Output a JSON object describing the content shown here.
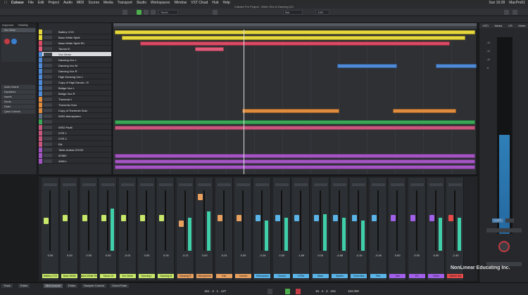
{
  "menubar": {
    "app": "Cubase",
    "items": [
      "File",
      "Edit",
      "Project",
      "Audio",
      "MIDI",
      "Scores",
      "Media",
      "Transport",
      "Studio",
      "Workspaces",
      "Window",
      "VST Cloud",
      "Hub",
      "Help"
    ],
    "clock": "Sun 16:28",
    "user": "MacPro61"
  },
  "window": {
    "title": "Cubase Pro Project - When She is Dancing 011"
  },
  "toolbar": {
    "touch": "Touch",
    "bar": "Bar",
    "quantize": "1/16"
  },
  "inspector": {
    "tabs": [
      "Inspector",
      "Visibility"
    ],
    "track": "Vox Verse",
    "sections": [
      "Audio Inserts",
      "Equalizers",
      "Inserts",
      "Sends",
      "Fader",
      "Quick Controls"
    ]
  },
  "tracks": [
    {
      "name": "Battery 3 03",
      "color": "#e6d83c",
      "sel": false
    },
    {
      "name": "Bass White Spirit",
      "color": "#e6d83c",
      "sel": false
    },
    {
      "name": "Bass White Spirit R0",
      "color": "#d94a64",
      "sel": false
    },
    {
      "name": "Taurus III",
      "color": "#e05b7a",
      "sel": false
    },
    {
      "name": "Vox Verse",
      "color": "#4f8ad6",
      "sel": true
    },
    {
      "name": "Dancing Vox L",
      "color": "#4f8ad6",
      "sel": false
    },
    {
      "name": "Dancing Vox M",
      "color": "#4f8ad6",
      "sel": false
    },
    {
      "name": "Dancing Vox R",
      "color": "#4f8ad6",
      "sel": false
    },
    {
      "name": "High Dancing Vox L",
      "color": "#4f8ad6",
      "sel": false
    },
    {
      "name": "Copy of High Dancin...R",
      "color": "#4f8ad6",
      "sel": false
    },
    {
      "name": "Bridge Vox L",
      "color": "#4f8ad6",
      "sel": false
    },
    {
      "name": "Bridge Vox R",
      "color": "#4f8ad6",
      "sel": false
    },
    {
      "name": "Theremin I",
      "color": "#e08c3e",
      "sel": false
    },
    {
      "name": "Theremin Solo",
      "color": "#e08c3e",
      "sel": false
    },
    {
      "name": "Copy of Theremin Solo",
      "color": "#e08c3e",
      "sel": false
    },
    {
      "name": "WSD Atmosphere",
      "color": "#5f6e82",
      "sel": false
    },
    {
      "name": "",
      "color": "#3aa856",
      "sel": false
    },
    {
      "name": "WSD Pad6",
      "color": "#c8577e",
      "sel": false
    },
    {
      "name": "GTR 1",
      "color": "#c8577e",
      "sel": false
    },
    {
      "name": "GTR 2",
      "color": "#c8577e",
      "sel": false
    },
    {
      "name": "Elk",
      "color": "#c8577e",
      "sel": false
    },
    {
      "name": "Table Arabia GOOD",
      "color": "#a355c2",
      "sel": false
    },
    {
      "name": "AT860",
      "color": "#a355c2",
      "sel": false
    },
    {
      "name": "4060 L",
      "color": "#a355c2",
      "sel": false
    }
  ],
  "mixer": {
    "channels": [
      {
        "name": "Battery 3 03",
        "val": "0.00",
        "color": "#c8e86a",
        "meter": 0.0,
        "cap": 0.5
      },
      {
        "name": "Bass White",
        "val": "0.00",
        "color": "#c8e86a",
        "meter": 0.0,
        "cap": 0.55
      },
      {
        "name": "Bass White R0",
        "val": "0.00",
        "color": "#c8e86a",
        "meter": 0.0,
        "cap": 0.55
      },
      {
        "name": "Taurus III",
        "val": "0.00",
        "color": "#c8e86a",
        "meter": 0.7,
        "cap": 0.55
      },
      {
        "name": "Vox Verse",
        "val": "-0.01",
        "color": "#c8e86a",
        "meter": 0.0,
        "cap": 0.55
      },
      {
        "name": "Dancing L",
        "val": "0.00",
        "color": "#c8e86a",
        "meter": 0.0,
        "cap": 0.55
      },
      {
        "name": "Dancing M",
        "val": "0.00",
        "color": "#c8e86a",
        "meter": 0.0,
        "cap": 0.55
      },
      {
        "name": "Dancing R",
        "val": "-0.21",
        "color": "#e8a060",
        "meter": 0.55,
        "cap": 0.45
      },
      {
        "name": "Microphone",
        "val": "0.00",
        "color": "#e8a060",
        "meter": 0.65,
        "cap": 0.9
      },
      {
        "name": "Fall",
        "val": "-0.01",
        "color": "#e8a060",
        "meter": 0.0,
        "cap": 0.55
      },
      {
        "name": "Current",
        "val": "0.00",
        "color": "#e8a060",
        "meter": 0.0,
        "cap": 0.55
      },
      {
        "name": "Percussion",
        "val": "-4.26",
        "color": "#5ab4e8",
        "meter": 0.5,
        "cap": 0.55
      },
      {
        "name": "Chorus",
        "val": "0.00",
        "color": "#5ab4e8",
        "meter": 0.55,
        "cap": 0.55
      },
      {
        "name": "GTRs",
        "val": "-1.69",
        "color": "#5ab4e8",
        "meter": 0.0,
        "cap": 0.55
      },
      {
        "name": "Bass",
        "val": "0.00",
        "color": "#5ab4e8",
        "meter": 0.6,
        "cap": 0.55
      },
      {
        "name": "Synths",
        "val": "-4.88",
        "color": "#5ab4e8",
        "meter": 0.55,
        "cap": 0.55
      },
      {
        "name": "Drum Bus",
        "val": "-4.10",
        "color": "#5ab4e8",
        "meter": 0.5,
        "cap": 0.55
      },
      {
        "name": "Rev",
        "val": "-0.45",
        "color": "#5ab4e8",
        "meter": 0.0,
        "cap": 0.55
      },
      {
        "name": "Vox",
        "val": "0.60",
        "color": "#a060e8",
        "meter": 0.0,
        "cap": 0.55
      },
      {
        "name": "FX",
        "val": "0.00",
        "color": "#a060e8",
        "meter": 0.0,
        "cap": 0.55
      },
      {
        "name": "Echo",
        "val": "0.00",
        "color": "#a060e8",
        "meter": 0.55,
        "cap": 0.55
      },
      {
        "name": "Stereo Out",
        "val": "-2.40",
        "color": "#e84a4a",
        "meter": 0.55,
        "cap": 0.55
      }
    ]
  },
  "rack": {
    "tabs": [
      "VSTi",
      "Media",
      "CR",
      "Meter"
    ],
    "meter_level": 0.72,
    "mode": "LUFS",
    "knob": "",
    "values": [
      "-13",
      "-12",
      "-10",
      "-8"
    ]
  },
  "bottom": {
    "tabs": [
      "Track",
      "Editor",
      "MixConsole",
      "Editor",
      "Sampler Control",
      "Chord Pads"
    ],
    "position_left": "151 . 3 . 1 . 127",
    "position_right": "15 . 4 . 3 . 104",
    "tempo": "110.000",
    "brand": "NonLinear Educating Inc."
  }
}
